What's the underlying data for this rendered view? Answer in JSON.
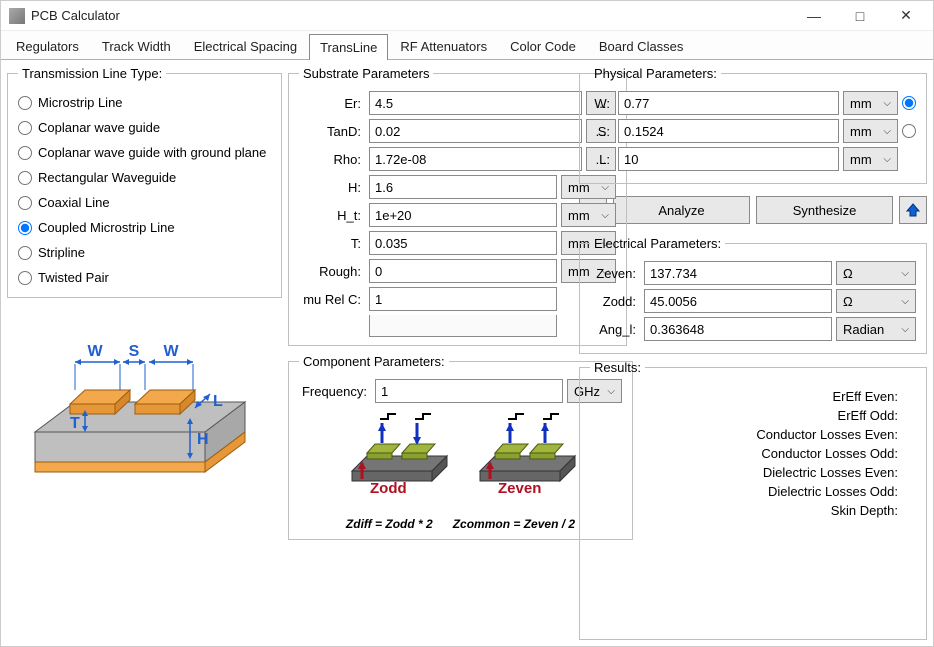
{
  "window": {
    "title": "PCB Calculator"
  },
  "tabs": [
    {
      "label": "Regulators",
      "active": false
    },
    {
      "label": "Track Width",
      "active": false
    },
    {
      "label": "Electrical Spacing",
      "active": false
    },
    {
      "label": "TransLine",
      "active": true
    },
    {
      "label": "RF Attenuators",
      "active": false
    },
    {
      "label": "Color Code",
      "active": false
    },
    {
      "label": "Board Classes",
      "active": false
    }
  ],
  "transline": {
    "group_label": "Transmission Line Type:",
    "options": [
      "Microstrip Line",
      "Coplanar wave guide",
      "Coplanar wave guide with ground plane",
      "Rectangular Waveguide",
      "Coaxial Line",
      "Coupled Microstrip Line",
      "Stripline",
      "Twisted Pair"
    ],
    "selected_index": 5
  },
  "substrate": {
    "group_label": "Substrate Parameters",
    "rows": [
      {
        "label": "Er:",
        "value": "4.5",
        "aux": "button"
      },
      {
        "label": "TanD:",
        "value": "0.02",
        "aux": "button"
      },
      {
        "label": "Rho:",
        "value": "1.72e-08",
        "aux": "button"
      },
      {
        "label": "H:",
        "value": "1.6",
        "aux": "unit",
        "unit": "mm"
      },
      {
        "label": "H_t:",
        "value": "1e+20",
        "aux": "unit",
        "unit": "mm"
      },
      {
        "label": "T:",
        "value": "0.035",
        "aux": "unit",
        "unit": "mm"
      },
      {
        "label": "Rough:",
        "value": "0",
        "aux": "unit",
        "unit": "mm"
      },
      {
        "label": "mu Rel C:",
        "value": "1",
        "aux": "none"
      }
    ]
  },
  "component": {
    "group_label": "Component Parameters:",
    "frequency_label": "Frequency:",
    "frequency_value": "1",
    "frequency_unit": "GHz",
    "diagram_zodd": "Zodd",
    "diagram_zeven": "Zeven",
    "zdiff_label": "Zdiff = Zodd * 2",
    "zcommon_label": "Zcommon = Zeven / 2"
  },
  "physical": {
    "group_label": "Physical Parameters:",
    "rows": [
      {
        "label": "W:",
        "value": "0.77",
        "unit": "mm",
        "radio": true,
        "radio_selected": true
      },
      {
        "label": "S:",
        "value": "0.1524",
        "unit": "mm",
        "radio": true,
        "radio_selected": false
      },
      {
        "label": "L:",
        "value": "10",
        "unit": "mm",
        "radio": false
      }
    ]
  },
  "actions": {
    "analyze": "Analyze",
    "synthesize": "Synthesize"
  },
  "electrical": {
    "group_label": "Electrical Parameters:",
    "rows": [
      {
        "label": "Zeven:",
        "value": "137.734",
        "unit": "Ω"
      },
      {
        "label": "Zodd:",
        "value": "45.0056",
        "unit": "Ω"
      },
      {
        "label": "Ang_l:",
        "value": "0.363648",
        "unit": "Radian"
      }
    ]
  },
  "results": {
    "group_label": "Results:",
    "rows": [
      "ErEff Even:",
      "ErEff Odd:",
      "Conductor Losses Even:",
      "Conductor Losses Odd:",
      "Dielectric Losses Even:",
      "Dielectric Losses Odd:",
      "Skin Depth:"
    ]
  },
  "diagram_labels": {
    "W": "W",
    "S": "S",
    "W2": "W",
    "L": "L",
    "T": "T",
    "H": "H"
  }
}
